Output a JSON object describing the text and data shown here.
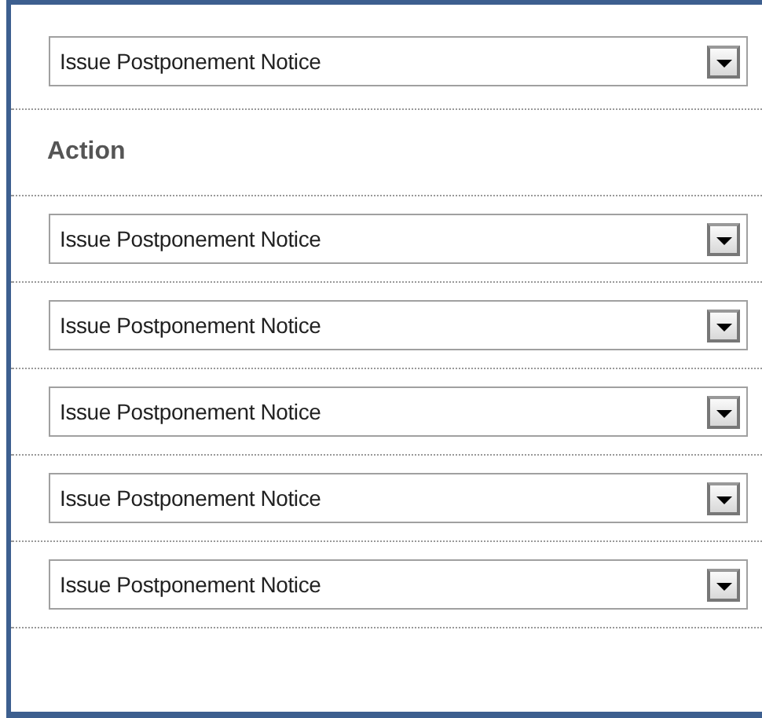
{
  "rows": [
    {
      "kind": "select",
      "value": "Issue Postponement Notice"
    },
    {
      "kind": "heading",
      "text": "Action"
    },
    {
      "kind": "select",
      "value": "Issue Postponement Notice"
    },
    {
      "kind": "select",
      "value": "Issue Postponement Notice"
    },
    {
      "kind": "select",
      "value": "Issue Postponement Notice"
    },
    {
      "kind": "select",
      "value": "Issue Postponement Notice"
    },
    {
      "kind": "select",
      "value": "Issue Postponement Notice"
    }
  ]
}
